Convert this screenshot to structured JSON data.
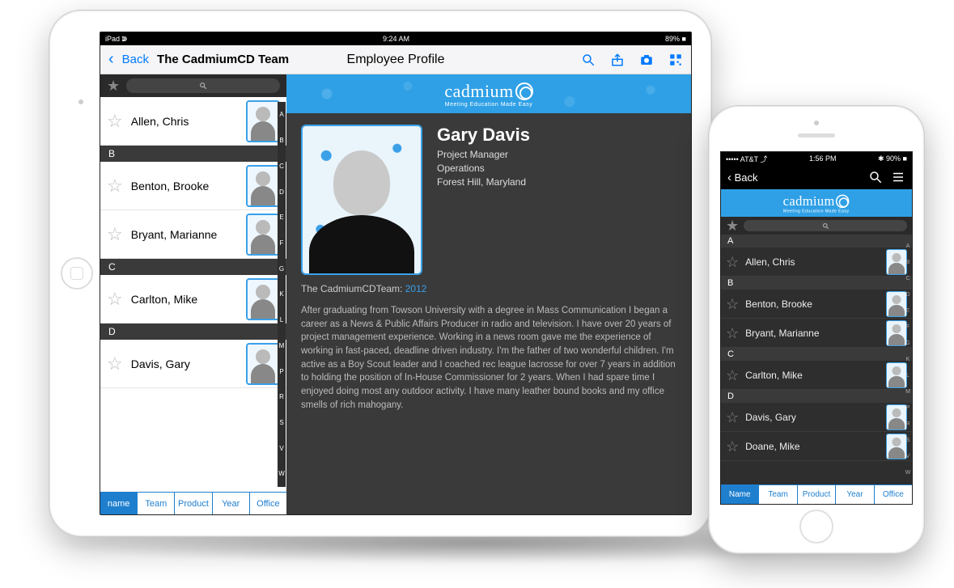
{
  "ipad": {
    "status": {
      "left": "iPad ↇ",
      "center": "9:24 AM",
      "right": "89% ■"
    },
    "nav": {
      "back": "Back",
      "title": "The CadmiumCD Team",
      "center": "Employee Profile"
    },
    "search_placeholder": "",
    "sections": [
      {
        "letter": "A",
        "rows": [
          {
            "name": "Allen, Chris"
          }
        ]
      },
      {
        "letter": "B",
        "rows": [
          {
            "name": "Benton, Brooke"
          },
          {
            "name": "Bryant, Marianne"
          }
        ]
      },
      {
        "letter": "C",
        "rows": [
          {
            "name": "Carlton, Mike"
          }
        ]
      },
      {
        "letter": "D",
        "rows": [
          {
            "name": "Davis, Gary"
          }
        ]
      }
    ],
    "index_letters": [
      "A",
      "B",
      "C",
      "D",
      "E",
      "F",
      "G",
      "K",
      "L",
      "M",
      "P",
      "R",
      "S",
      "V",
      "W"
    ],
    "tabs": [
      "name",
      "Team",
      "Product",
      "Year",
      "Office"
    ],
    "active_tab": 0,
    "brand": {
      "name": "cadmium",
      "suffix": "CD",
      "tagline": "Meeting Education Made Easy"
    },
    "profile": {
      "name": "Gary Davis",
      "role": "Project Manager",
      "dept": "Operations",
      "location": "Forest Hill, Maryland",
      "joined_label": "The CadmiumCDTeam:",
      "joined_year": "2012",
      "bio": "After graduating from Towson University with a degree in Mass Communication I began a career as a News & Public Affairs Producer in radio and television. I have over 20 years of project management experience. Working in a news room gave me the experience of working in fast-paced, deadline driven industry. I'm the father of two wonderful children. I'm active as a Boy Scout leader and I coached rec league lacrosse for over 7 years in addition to holding the position of In-House Commissioner for 2 years. When I had spare time I enjoyed doing most any outdoor activity. I have many leather bound books and my office smells of rich mahogany."
    }
  },
  "iphone": {
    "status": {
      "left": "••••• AT&T ⤴",
      "center": "1:56 PM",
      "right": "✱ 90% ■"
    },
    "nav": {
      "back": "Back"
    },
    "brand": {
      "name": "cadmium",
      "suffix": "CD",
      "tagline": "Meeting Education Made Easy"
    },
    "sections": [
      {
        "letter": "A",
        "rows": [
          {
            "name": "Allen, Chris"
          }
        ]
      },
      {
        "letter": "B",
        "rows": [
          {
            "name": "Benton, Brooke"
          },
          {
            "name": "Bryant, Marianne"
          }
        ]
      },
      {
        "letter": "C",
        "rows": [
          {
            "name": "Carlton, Mike"
          }
        ]
      },
      {
        "letter": "D",
        "rows": [
          {
            "name": "Davis, Gary"
          },
          {
            "name": "Doane, Mike"
          }
        ]
      }
    ],
    "index_letters": [
      "A",
      "B",
      "C",
      "D",
      "E",
      "F",
      "G",
      "K",
      "L",
      "M",
      "P",
      "R",
      "S",
      "V",
      "W"
    ],
    "tabs": [
      "Name",
      "Team",
      "Product",
      "Year",
      "Office"
    ],
    "active_tab": 0
  }
}
